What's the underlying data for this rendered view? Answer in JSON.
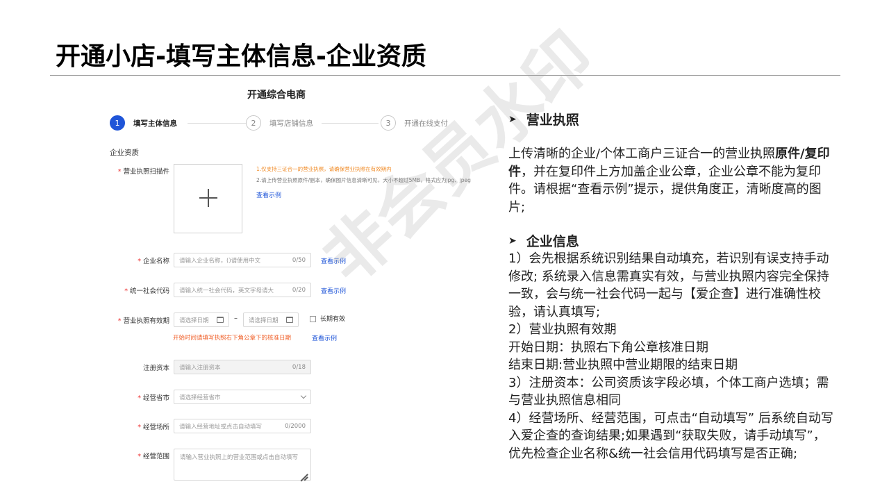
{
  "slide": {
    "title": "开通小店-填写主体信息-企业资质",
    "watermark": "非会员水印"
  },
  "form": {
    "page_title": "开通综合电商",
    "steps": [
      {
        "num": "1",
        "label": "填写主体信息",
        "active": true
      },
      {
        "num": "2",
        "label": "填写店铺信息",
        "active": false
      },
      {
        "num": "3",
        "label": "开通在线支付",
        "active": false
      }
    ],
    "section": "企业资质",
    "license_scan": {
      "label": "营业执照扫描件",
      "hint1": "1.仅支持三证合一的营业执照，请确保营业执照在有效期内",
      "hint2": "2.请上传营业执照原件/副本，确保图片信息清晰可见，大小不超过5MB，格式应为jpg、jpeg",
      "example_link": "查看示例"
    },
    "company_name": {
      "label": "企业名称",
      "placeholder": "请输入企业名称，()请使用中文",
      "count": "0/50",
      "example_link": "查看示例"
    },
    "credit_code": {
      "label": "统一社会代码",
      "placeholder": "请输入统一社会代码，英文字母请大",
      "count": "0/20",
      "example_link": "查看示例"
    },
    "validity": {
      "label": "营业执照有效期",
      "start_placeholder": "请选择日期",
      "end_placeholder": "请选择日期",
      "separator": "–",
      "long_term": "长期有效",
      "hint": "开始时间请填写执照右下角公章下的核准日期",
      "example_link": "查看示例"
    },
    "capital": {
      "label": "注册资本",
      "placeholder": "请输入注册资本",
      "count": "0/18"
    },
    "province": {
      "label": "经营省市",
      "placeholder": "请选择经营省市"
    },
    "address": {
      "label": "经营场所",
      "placeholder": "请输入经营地址或点击自动填写",
      "count": "0/2000"
    },
    "scope": {
      "label": "经营范围",
      "placeholder": "请输入营业执照上的营业范围或点击自动填写"
    }
  },
  "panel": {
    "h1": "营业执照",
    "p1_a": "上传清晰的企业/个体工商户三证合一的营业执照",
    "p1_b": "原件/复印件",
    "p1_c": "，并在复印件上方加盖企业公章，企业公章不能为复印件。请根据“查看示例”提示，提供角度正，清晰度高的图片;",
    "h2": "企业信息",
    "items": [
      "1）会先根据系统识别结果自动填充，若识别有误支持手动修改; 系统录入信息需真实有效，与营业执照内容完全保持一致，会与统一社会代码一起与【爱企查】进行准确性校验，请认真填写;",
      "2）营业执照有效期",
      "开始日期：执照右下角公章核准日期",
      "结束日期:营业执照中营业期限的结束日期",
      "3）注册资本：公司资质该字段必填，个体工商户选填；需与营业执照信息相同",
      "4）经营场所、经营范围，可点击“自动填写” 后系统自动写入爱企查的查询结果;如果遇到“获取失败，请手动填写”，优先检查企业名称&统一社会信用代码填写是否正确;"
    ]
  }
}
